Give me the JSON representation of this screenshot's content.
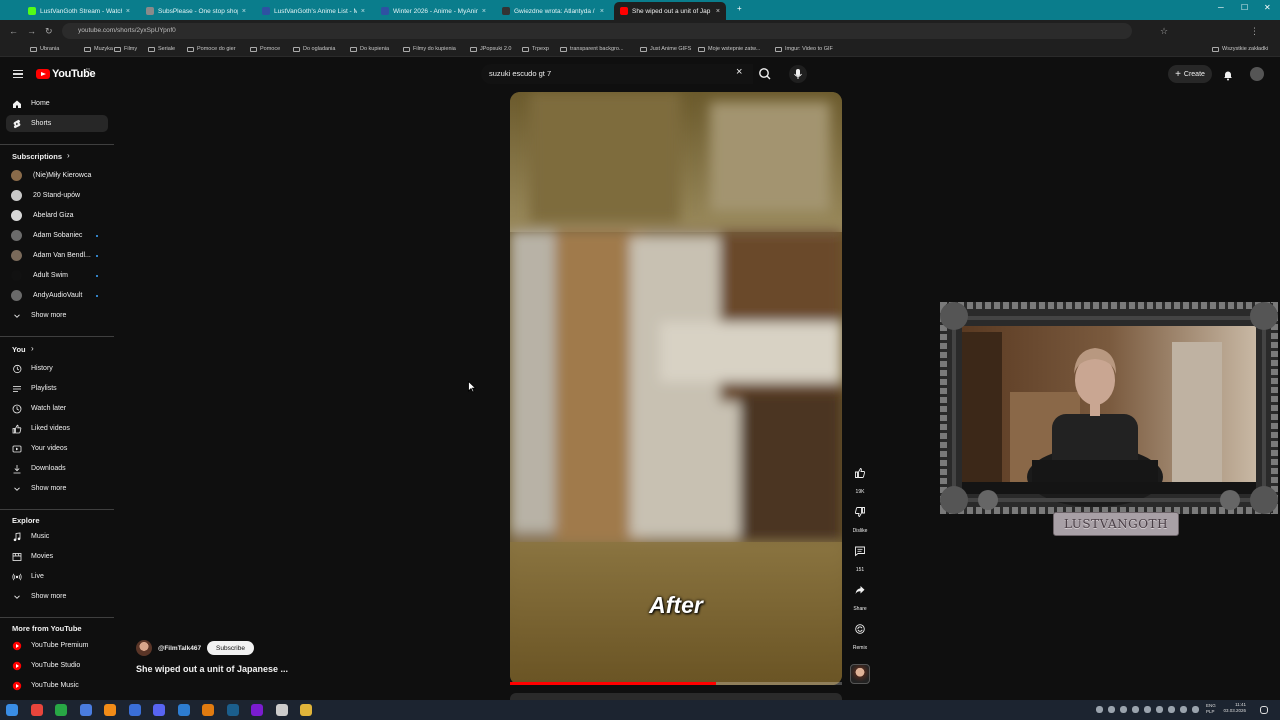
{
  "browser": {
    "tabs": [
      {
        "title": "LustVanGoth Stream - Watch L",
        "color": "#53fc18"
      },
      {
        "title": "SubsPlease - One stop shop fo",
        "color": "#8a8a8a"
      },
      {
        "title": "LustVanGoth's Anime List - My",
        "color": "#2e51a2"
      },
      {
        "title": "Winter 2026 - Anime - MyAnim",
        "color": "#2e51a2"
      },
      {
        "title": "Gwiezdne wrota: Atlantyda / St",
        "color": "#333333"
      },
      {
        "title": "She wiped out a unit of Jap",
        "color": "#ff0000"
      }
    ],
    "url": "youtube.com/shorts/2yxSpUYpnf0",
    "bookmarks": [
      "Ubrania",
      "Muzyka",
      "Filmy",
      "Seriale",
      "Pomoce do gier",
      "Pomoce",
      "Do ogladania",
      "Do kupienia",
      "Filmy do kupienia",
      "JPopsuki 2.0",
      "Trpexp",
      "transparent backgro...",
      "Just Anime GIFS",
      "Moje wstepnie zatw...",
      "Imgur: Video to GIF",
      "Wszystkie zakładki"
    ]
  },
  "header": {
    "wordmark": "YouTube",
    "region": "PL",
    "search_value": "suzuki escudo gt 7",
    "create_label": "Create"
  },
  "sidebar": {
    "main": [
      {
        "label": "Home",
        "icon": "home-icon"
      },
      {
        "label": "Shorts",
        "icon": "shorts-icon",
        "active": true
      }
    ],
    "subscriptions_heading": "Subscriptions",
    "subscriptions": [
      {
        "label": "(Nie)Miły Kierowca",
        "color": "#8a6b4a",
        "dot": false
      },
      {
        "label": "20 Stand-upów",
        "color": "#c9c9c9",
        "dot": false
      },
      {
        "label": "Abelard Giza",
        "color": "#d8d8d8",
        "dot": false
      },
      {
        "label": "Adam Sobaniec",
        "color": "#6b6b6b",
        "dot": true
      },
      {
        "label": "Adam Van Bendl...",
        "color": "#7a6a5a",
        "dot": true
      },
      {
        "label": "Adult Swim",
        "color": "#111111",
        "dot": true
      },
      {
        "label": "AndyAudioVault",
        "color": "#6a6a6a",
        "dot": true
      }
    ],
    "show_more": "Show more",
    "you_heading": "You",
    "you_items": [
      {
        "label": "History",
        "icon": "history-icon"
      },
      {
        "label": "Playlists",
        "icon": "playlists-icon"
      },
      {
        "label": "Watch later",
        "icon": "watch-later-icon"
      },
      {
        "label": "Liked videos",
        "icon": "liked-videos-icon"
      },
      {
        "label": "Your videos",
        "icon": "your-videos-icon"
      },
      {
        "label": "Downloads",
        "icon": "downloads-icon"
      }
    ],
    "explore_heading": "Explore",
    "explore_items": [
      {
        "label": "Music",
        "icon": "music-icon"
      },
      {
        "label": "Movies",
        "icon": "movies-icon"
      },
      {
        "label": "Live",
        "icon": "live-icon"
      }
    ],
    "more_heading": "More from YouTube",
    "more_items": [
      {
        "label": "YouTube Premium"
      },
      {
        "label": "YouTube Studio"
      },
      {
        "label": "YouTube Music"
      }
    ]
  },
  "short": {
    "overlay_text": "After",
    "channel": "@FilmTalk467",
    "subscribe_label": "Subscribe",
    "title": "She wiped out a unit of Japanese ...",
    "progress_fraction": 0.62,
    "likes": "19K",
    "dislike_label": "Dislike",
    "comments": "151",
    "share_label": "Share",
    "remix_label": "Remix"
  },
  "webcam": {
    "nameplate": "LUSTVANGOTH"
  },
  "taskbar": {
    "lang": "ENG",
    "layout": "PLP",
    "time": "11:41",
    "date": "03.03.2026"
  }
}
